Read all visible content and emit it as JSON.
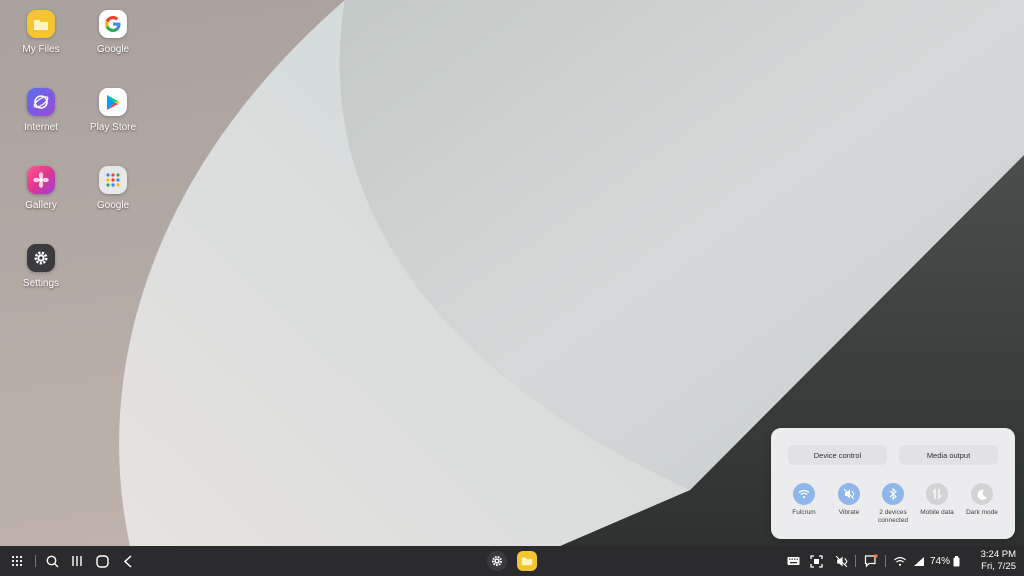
{
  "desktop": {
    "icons": [
      {
        "label": "My Files",
        "icon": "folder-icon"
      },
      {
        "label": "Google",
        "icon": "google-icon"
      },
      {
        "label": "Internet",
        "icon": "internet-icon"
      },
      {
        "label": "Play Store",
        "icon": "play-store-icon"
      },
      {
        "label": "Gallery",
        "icon": "gallery-icon"
      },
      {
        "label": "Google",
        "icon": "google-folder-icon"
      },
      {
        "label": "Settings",
        "icon": "settings-icon"
      }
    ]
  },
  "quick_panel": {
    "device_control": "Device control",
    "media_output": "Media output",
    "tiles": [
      {
        "label": "Fulcrum",
        "state": "on",
        "icon": "wifi-icon"
      },
      {
        "label": "Vibrate",
        "state": "on",
        "icon": "vibrate-icon"
      },
      {
        "label": "2 devices connected",
        "state": "on",
        "icon": "bluetooth-icon"
      },
      {
        "label": "Mobile data",
        "state": "off",
        "icon": "mobile-data-icon"
      },
      {
        "label": "Dark mode",
        "state": "off",
        "icon": "dark-mode-icon"
      }
    ]
  },
  "taskbar": {
    "battery": "74%",
    "time": "3:24 PM",
    "date": "Fri, 7/25"
  },
  "colors": {
    "accent": "#8fb6e8",
    "taskbar": "#2b2b2d",
    "panel": "#f4f4f6"
  }
}
